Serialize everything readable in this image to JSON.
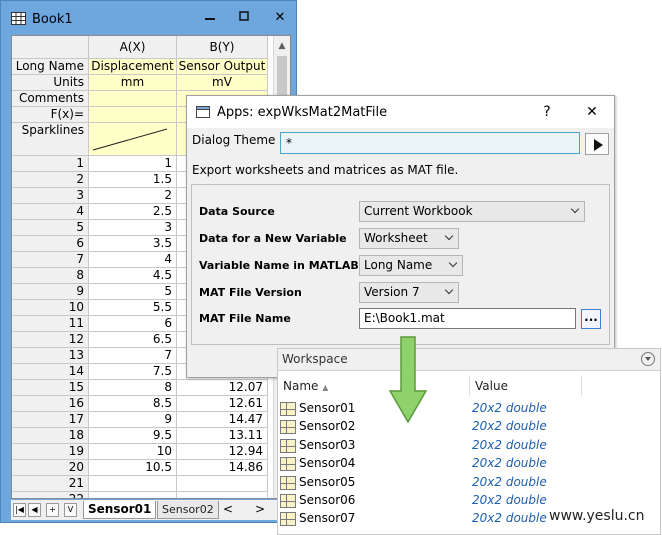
{
  "book": {
    "title": "Book1",
    "min_glyph": "▬",
    "max_glyph": "☐",
    "close_glyph": "✕",
    "columns": [
      {
        "header": "A(X)",
        "long_name": "Displacement",
        "units": "mm"
      },
      {
        "header": "B(Y)",
        "long_name": "Sensor Output",
        "units": "mV"
      }
    ],
    "row_labels": {
      "long_name": "Long Name",
      "units": "Units",
      "comments": "Comments",
      "fx": "F(x)=",
      "sparklines": "Sparklines"
    },
    "rows": [
      {
        "n": "1",
        "a": "1",
        "b": ""
      },
      {
        "n": "2",
        "a": "1.5",
        "b": ""
      },
      {
        "n": "3",
        "a": "2",
        "b": ""
      },
      {
        "n": "4",
        "a": "2.5",
        "b": ""
      },
      {
        "n": "5",
        "a": "3",
        "b": ""
      },
      {
        "n": "6",
        "a": "3.5",
        "b": ""
      },
      {
        "n": "7",
        "a": "4",
        "b": ""
      },
      {
        "n": "8",
        "a": "4.5",
        "b": ""
      },
      {
        "n": "9",
        "a": "5",
        "b": ""
      },
      {
        "n": "10",
        "a": "5.5",
        "b": ""
      },
      {
        "n": "11",
        "a": "6",
        "b": ""
      },
      {
        "n": "12",
        "a": "6.5",
        "b": ""
      },
      {
        "n": "13",
        "a": "7",
        "b": ""
      },
      {
        "n": "14",
        "a": "7.5",
        "b": ""
      },
      {
        "n": "15",
        "a": "8",
        "b": "12.07"
      },
      {
        "n": "16",
        "a": "8.5",
        "b": "12.61"
      },
      {
        "n": "17",
        "a": "9",
        "b": "14.47"
      },
      {
        "n": "18",
        "a": "9.5",
        "b": "13.11"
      },
      {
        "n": "19",
        "a": "10",
        "b": "12.94"
      },
      {
        "n": "20",
        "a": "10.5",
        "b": "14.86"
      },
      {
        "n": "21",
        "a": "",
        "b": ""
      },
      {
        "n": "22",
        "a": "",
        "b": ""
      }
    ],
    "nav_buttons": [
      "|◀",
      "◀",
      "+",
      "V"
    ],
    "sheet_tabs": [
      {
        "label": "Sensor01",
        "active": true
      },
      {
        "label": "Sensor02",
        "active": false
      }
    ],
    "sheet_nav_prev": "<",
    "sheet_nav_next": ">"
  },
  "dialog": {
    "title": "Apps: expWksMat2MatFile",
    "help_glyph": "?",
    "close_glyph": "✕",
    "theme_label": "Dialog Theme",
    "theme_value": "*",
    "description": "Export worksheets and matrices as MAT file.",
    "fields": [
      {
        "label": "Data Source",
        "value": "Current Workbook",
        "type": "combo",
        "width": 226
      },
      {
        "label": "Data for a New Variable",
        "value": "Worksheet",
        "type": "combo",
        "width": 100
      },
      {
        "label": "Variable Name in MATLAB by",
        "value": "Long Name",
        "type": "combo",
        "width": 104
      },
      {
        "label": "MAT File Version",
        "value": "Version 7",
        "type": "combo",
        "width": 100
      },
      {
        "label": "MAT File Name",
        "value": "E:\\Book1.mat",
        "type": "text",
        "width": 217
      }
    ],
    "browse_glyph": "..."
  },
  "workspace": {
    "title": "Workspace",
    "col_name": "Name",
    "col_name_sort": "▲",
    "col_value": "Value",
    "variables": [
      {
        "name": "Sensor01",
        "value": "20x2 double"
      },
      {
        "name": "Sensor02",
        "value": "20x2 double"
      },
      {
        "name": "Sensor03",
        "value": "20x2 double"
      },
      {
        "name": "Sensor04",
        "value": "20x2 double"
      },
      {
        "name": "Sensor05",
        "value": "20x2 double"
      },
      {
        "name": "Sensor06",
        "value": "20x2 double"
      },
      {
        "name": "Sensor07",
        "value": "20x2 double"
      }
    ]
  },
  "watermark": "www.yeslu.cn",
  "colors": {
    "accent": "#6da7dd",
    "arrow": "#8fd16a",
    "value_text": "#1e5fb0"
  }
}
